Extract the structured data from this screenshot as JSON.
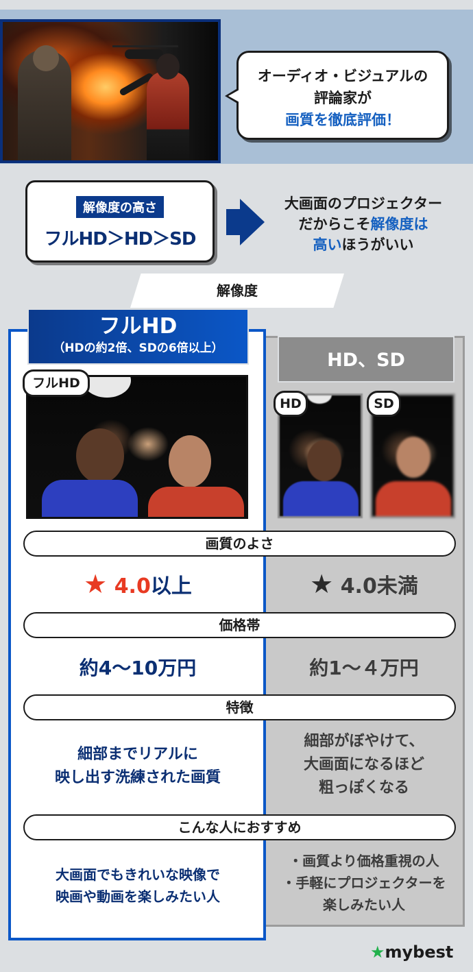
{
  "banner": {
    "bubble_line1": "オーディオ・ビジュアルの",
    "bubble_line2": "評論家が",
    "bubble_line3": "画質を徹底評価！"
  },
  "resolution": {
    "label": "解像度の高さ",
    "order": "フルHD＞HD＞SD",
    "note_line1": "大画面のプロジェクター",
    "note_line2_a": "だからこそ",
    "note_line2_b": "解像度は",
    "note_line3_a": "高い",
    "note_line3_b": "ほうがいい"
  },
  "section_title": "解像度",
  "columns": {
    "left": {
      "title": "フルHD",
      "subtitle": "（HDの約2倍、SDの6倍以上）",
      "photo_tag": "フルHD",
      "rating_star": "★",
      "rating_value": "4.0",
      "rating_suffix": "以上",
      "price": "約4〜10万円",
      "feature_line1": "細部までリアルに",
      "feature_line2": "映し出す洗練された画質",
      "reco_line1": "大画面でもきれいな映像で",
      "reco_line2": "映画や動画を楽しみたい人"
    },
    "right": {
      "title": "HD、SD",
      "photo_tag_hd": "HD",
      "photo_tag_sd": "SD",
      "rating_star": "★",
      "rating_value": "4.0未満",
      "price": "約1〜４万円",
      "feature_line1": "細部がぼやけて、",
      "feature_line2": "大画面になるほど",
      "feature_line3": "粗っぽくなる",
      "reco_line1": "・画質より価格重視の人",
      "reco_line2": "・手軽にプロジェクターを",
      "reco_line3": "楽しみたい人"
    }
  },
  "row_labels": {
    "quality": "画質のよさ",
    "price": "価格帯",
    "features": "特徴",
    "recommended": "こんな人におすすめ"
  },
  "brand": {
    "star": "★",
    "name": "mybest"
  },
  "colors": {
    "accent_blue": "#0b57c7",
    "navy": "#0b2f73",
    "highlight_blue": "#1560c0",
    "red": "#e83a22",
    "gray_panel": "#c9c9c9",
    "brand_green": "#22b14c"
  }
}
